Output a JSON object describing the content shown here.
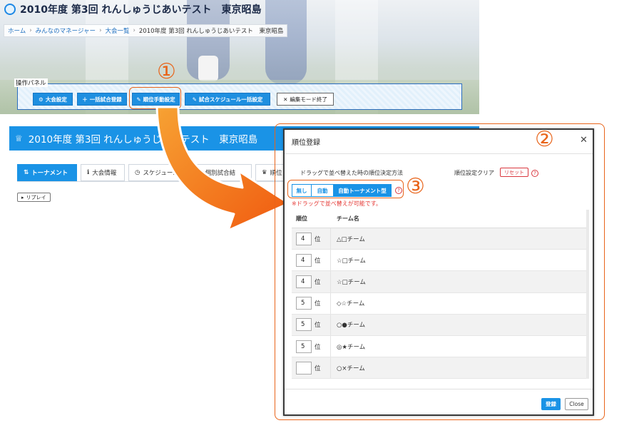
{
  "site": {
    "title": "2010年度 第3回 れんしゅうじあいテスト　東京昭島"
  },
  "breadcrumb": [
    {
      "label": "ホーム",
      "link": true
    },
    {
      "label": "みんなのマネージャー",
      "link": true
    },
    {
      "label": "大会一覧",
      "link": true
    },
    {
      "label": "2010年度 第3回 れんしゅうじあいテスト　東京昭島",
      "link": false
    }
  ],
  "operation_panel": {
    "label": "操作パネル",
    "buttons": {
      "tournament_settings": {
        "label": "大会設定",
        "icon": "gear-icon"
      },
      "bulk_register": {
        "label": "一括試合登録",
        "icon": "plus-icon"
      },
      "manual_rank": {
        "label": "順位手動設定",
        "icon": "edit-icon"
      },
      "schedule_bulk": {
        "label": "試合スケジュール一括設定",
        "icon": "edit-icon"
      },
      "exit_edit": {
        "label": "編集モード終了",
        "icon": "close-icon"
      }
    }
  },
  "page_header": {
    "title": "2010年度 第3回 れんしゅうじあいテスト　東京昭島",
    "icon": "crown-icon"
  },
  "tabs": [
    {
      "label": "トーナメント",
      "icon": "ranking-icon",
      "active": true
    },
    {
      "label": "大会情報",
      "icon": "info-icon",
      "active": false
    },
    {
      "label": "スケジュール",
      "icon": "clock-icon",
      "active": false
    },
    {
      "label": "個別試合結",
      "icon": "list-icon",
      "active": false
    },
    {
      "label": "順位",
      "icon": "trophy-icon",
      "active": false
    }
  ],
  "replay_button": "リプレイ",
  "annotations": {
    "one": "①",
    "two": "②",
    "three": "③"
  },
  "modal": {
    "title": "順位登録",
    "sort_method_label": "ドラッグで並べ替えた時の順位決定方法",
    "clear_label": "順位設定クリア",
    "reset_label": "リセット",
    "help": "?",
    "segments": {
      "none": "無し",
      "auto": "自動",
      "auto_tournament": "自動トーナメント型"
    },
    "selected_segment": "自動トーナメント型",
    "drag_note": "※ドラッグで並べ替えが可能です。",
    "columns": {
      "rank": "順位",
      "team": "チーム名"
    },
    "rank_suffix": "位",
    "rows": [
      {
        "rank": "4",
        "suffix": "位",
        "team": "△□チーム"
      },
      {
        "rank": "4",
        "suffix": "位",
        "team": "☆□チーム"
      },
      {
        "rank": "4",
        "suffix": "位",
        "team": "☆□チーム"
      },
      {
        "rank": "5",
        "suffix": "位",
        "team": "◇☆チーム"
      },
      {
        "rank": "5",
        "suffix": "位",
        "team": "○●チーム"
      },
      {
        "rank": "5",
        "suffix": "位",
        "team": "◎★チーム"
      },
      {
        "rank": "",
        "suffix": "位",
        "team": "○×チーム"
      }
    ],
    "save_label": "登録",
    "close_label": "Close"
  },
  "colors": {
    "accent_blue": "#1a93e6",
    "annotation_orange": "#e8641a",
    "warning_red": "#e53935"
  }
}
